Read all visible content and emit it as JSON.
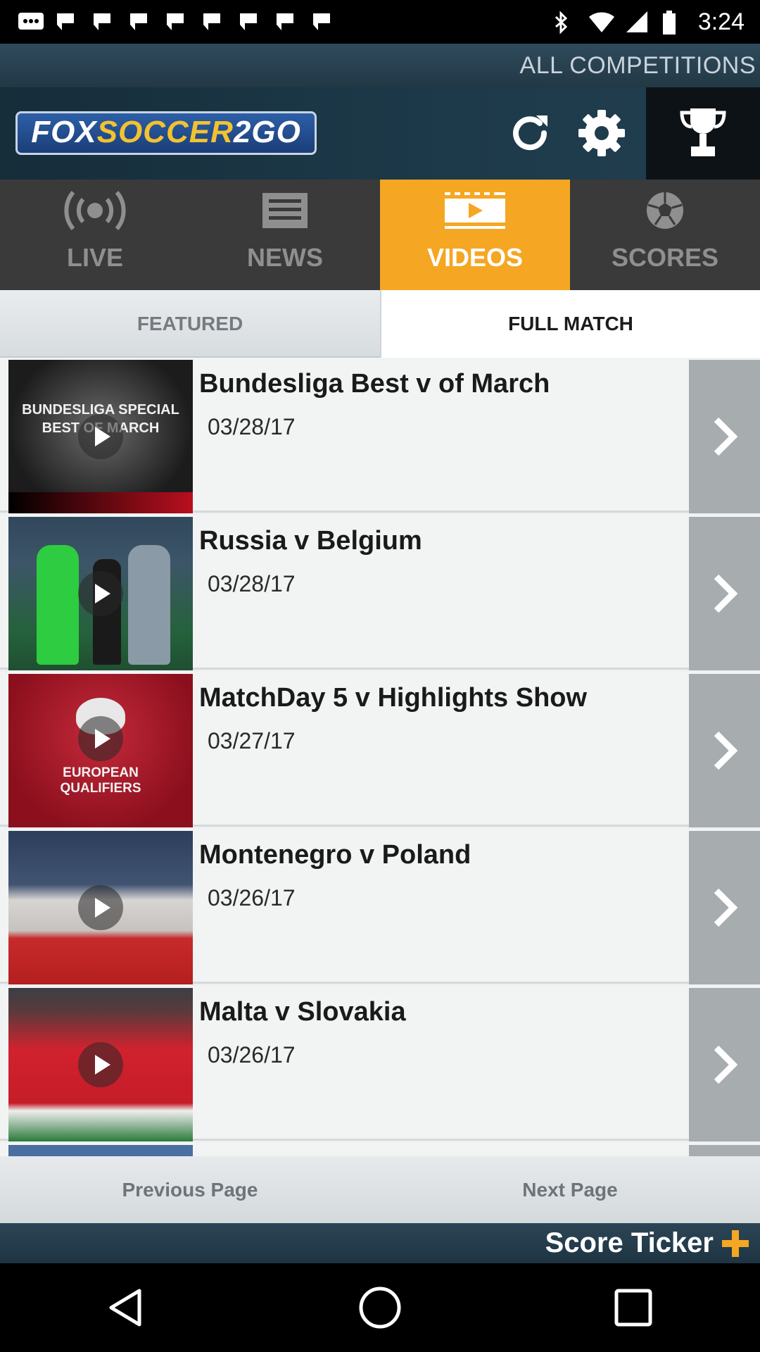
{
  "status_bar": {
    "time": "3:24"
  },
  "competitions_label": "ALL COMPETITIONS",
  "logo": {
    "part1": "FOX",
    "part2": "SOCCER",
    "part3": "2GO"
  },
  "main_tabs": [
    {
      "label": "LIVE",
      "icon": "broadcast-icon",
      "active": false
    },
    {
      "label": "NEWS",
      "icon": "news-icon",
      "active": false
    },
    {
      "label": "VIDEOS",
      "icon": "video-icon",
      "active": true
    },
    {
      "label": "SCORES",
      "icon": "soccer-ball-icon",
      "active": false
    }
  ],
  "sub_tabs": [
    {
      "label": "FEATURED",
      "active": false
    },
    {
      "label": "FULL MATCH",
      "active": true
    }
  ],
  "videos": [
    {
      "title": "Bundesliga Best v of March",
      "date": "03/28/17",
      "thumb_text": "BUNDESLIGA SPECIAL\nBEST OF MARCH"
    },
    {
      "title": "Russia v Belgium",
      "date": "03/28/17"
    },
    {
      "title": "MatchDay 5 v Highlights Show",
      "date": "03/27/17",
      "thumb_text": "EUROPEAN\nQUALIFIERS"
    },
    {
      "title": "Montenegro v Poland",
      "date": "03/26/17"
    },
    {
      "title": "Malta v Slovakia",
      "date": "03/26/17"
    }
  ],
  "pager": {
    "previous": "Previous Page",
    "next": "Next Page"
  },
  "ticker": {
    "label": "Score Ticker"
  },
  "colors": {
    "accent": "#f5a623",
    "header_bg": "#1d3a4a"
  }
}
